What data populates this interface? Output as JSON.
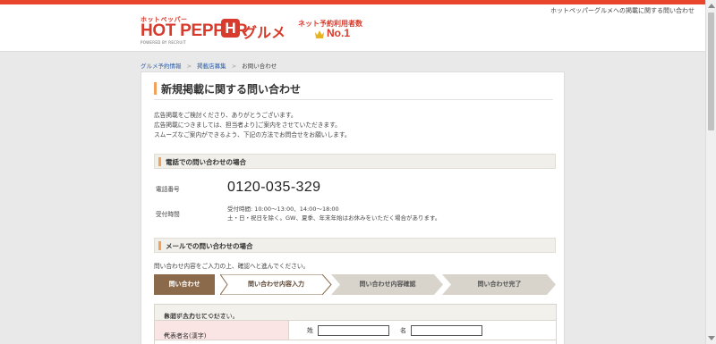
{
  "header": {
    "top_link": "ホットペッパーグルメへの掲載に関する問い合わせ",
    "logo": {
      "small_text": "ホットペッパー",
      "main_text": "HOT PEPPER",
      "icon_letter": "H",
      "gourmet_text": "グルメ",
      "powered_by": "POWERED BY RECRUIT"
    },
    "rank": {
      "label": "ネット予約利用者数",
      "no1": "No.1"
    }
  },
  "breadcrumb": {
    "items": [
      "グルメ予約情報",
      "掲載店募集",
      "お問い合わせ"
    ],
    "separator": ">"
  },
  "page": {
    "title": "新規掲載に関する問い合わせ",
    "intro": [
      "広告掲載をご検討くださり、ありがとうございます。",
      "広告掲載につきましては、担当者より]ご案内をさせていただきます。",
      "スムーズなご案内ができるよう、下記の方法でお問合せをお願いします。"
    ]
  },
  "phone_section": {
    "heading": "電話での問い合わせの場合",
    "number_label": "電話番号",
    "number": "0120-035-329",
    "hours_label": "受付時間",
    "hours_line1": "受付時間: 10:00〜13:00、14:00〜18:00",
    "hours_line2": "土・日・祝日を除く。GW、夏季、年末年始はお休みをいただく場合があります。"
  },
  "mail_section": {
    "heading": "メールでの問い合わせの場合",
    "intro": "問い合わせ内容をご入力の上、確認へと進んでください。",
    "steps": [
      {
        "label": "問い合わせ",
        "state": "done"
      },
      {
        "label": "問い合わせ内容入力",
        "state": "current"
      },
      {
        "label": "問い合わせ内容確認",
        "state": "todo"
      },
      {
        "label": "問い合わせ完了",
        "state": "todo"
      }
    ]
  },
  "form": {
    "header_pre": "お問い合わせについて",
    "header_mark": "※",
    "header_post": "は必ず入力してください。",
    "name_label": "代表者名(漢字)",
    "required_mark": "※",
    "last_name_label": "姓",
    "first_name_label": "名",
    "last_name_value": "",
    "first_name_value": ""
  },
  "colors": {
    "brand": "#d83a2b",
    "accent": "#f2a15a",
    "step_done": "#8a6a4a",
    "step_todo": "#d8d4cc",
    "required_bg": "#fbe4e4"
  }
}
